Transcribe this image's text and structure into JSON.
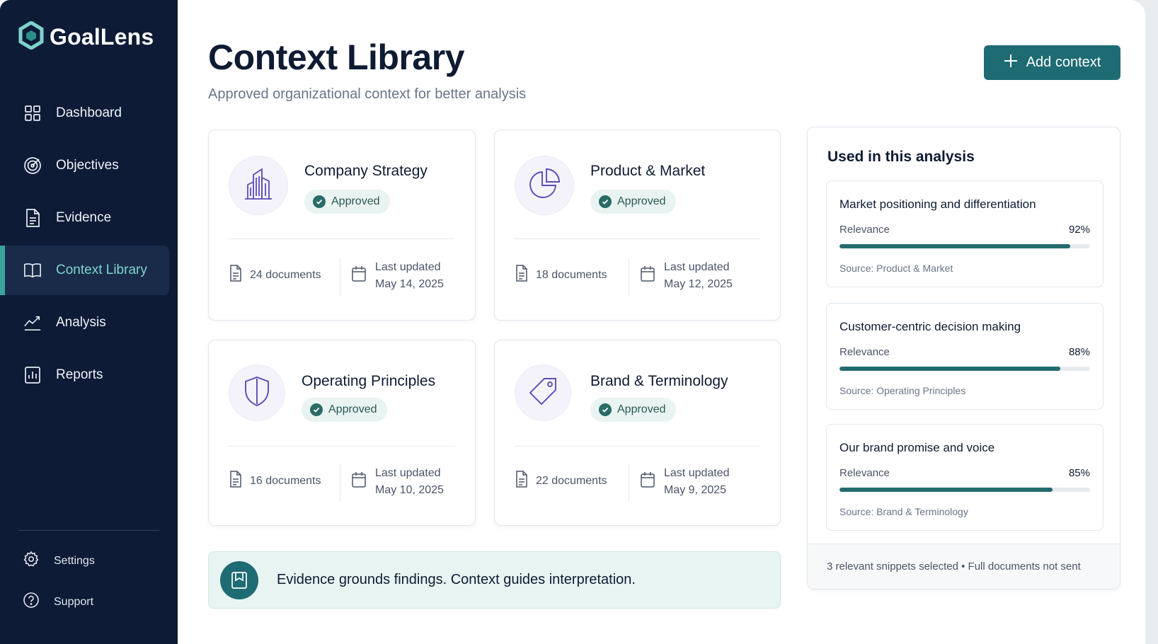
{
  "app": {
    "name": "GoalLens"
  },
  "sidebar": {
    "items": [
      {
        "label": "Dashboard",
        "icon": "dashboard-grid-icon"
      },
      {
        "label": "Objectives",
        "icon": "target-icon"
      },
      {
        "label": "Evidence",
        "icon": "document-icon"
      },
      {
        "label": "Context Library",
        "icon": "book-icon",
        "active": true
      },
      {
        "label": "Analysis",
        "icon": "trend-line-icon"
      },
      {
        "label": "Reports",
        "icon": "bar-chart-icon"
      }
    ],
    "footer": [
      {
        "label": "Settings",
        "icon": "gear-icon"
      },
      {
        "label": "Support",
        "icon": "help-circle-icon"
      }
    ]
  },
  "header": {
    "title": "Context Library",
    "subtitle": "Approved organizational context for better analysis",
    "add_button": "Add context"
  },
  "cards": [
    {
      "title": "Company Strategy",
      "status": "Approved",
      "icon": "building-icon",
      "documents": "24 documents",
      "updated_label": "Last updated",
      "updated_date": "May 14, 2025"
    },
    {
      "title": "Product & Market",
      "status": "Approved",
      "icon": "pie-chart-icon",
      "documents": "18 documents",
      "updated_label": "Last updated",
      "updated_date": "May 12, 2025"
    },
    {
      "title": "Operating Principles",
      "status": "Approved",
      "icon": "shield-icon",
      "documents": "16 documents",
      "updated_label": "Last updated",
      "updated_date": "May 10, 2025"
    },
    {
      "title": "Brand & Terminology",
      "status": "Approved",
      "icon": "tag-icon",
      "documents": "22 documents",
      "updated_label": "Last updated",
      "updated_date": "May 9, 2025"
    }
  ],
  "panel": {
    "title": "Used in this analysis",
    "snippets": [
      {
        "title": "Market positioning and differentiation",
        "relevance_label": "Relevance",
        "relevance": "92%",
        "relevance_value": 0.92,
        "source": "Source: Product & Market"
      },
      {
        "title": "Customer-centric decision making",
        "relevance_label": "Relevance",
        "relevance": "88%",
        "relevance_value": 0.88,
        "source": "Source: Operating Principles"
      },
      {
        "title": "Our brand promise and voice",
        "relevance_label": "Relevance",
        "relevance": "85%",
        "relevance_value": 0.85,
        "source": "Source: Brand & Terminology"
      }
    ],
    "footer": "3 relevant snippets selected • Full documents not sent"
  },
  "banner": {
    "text": "Evidence grounds findings. Context guides interpretation.",
    "icon": "bookmark-icon"
  },
  "colors": {
    "sidebar": "#0e1b36",
    "accent": "#1e6b73",
    "active_text": "#7ed3cc",
    "icon_purple": "#5b4bb8"
  }
}
